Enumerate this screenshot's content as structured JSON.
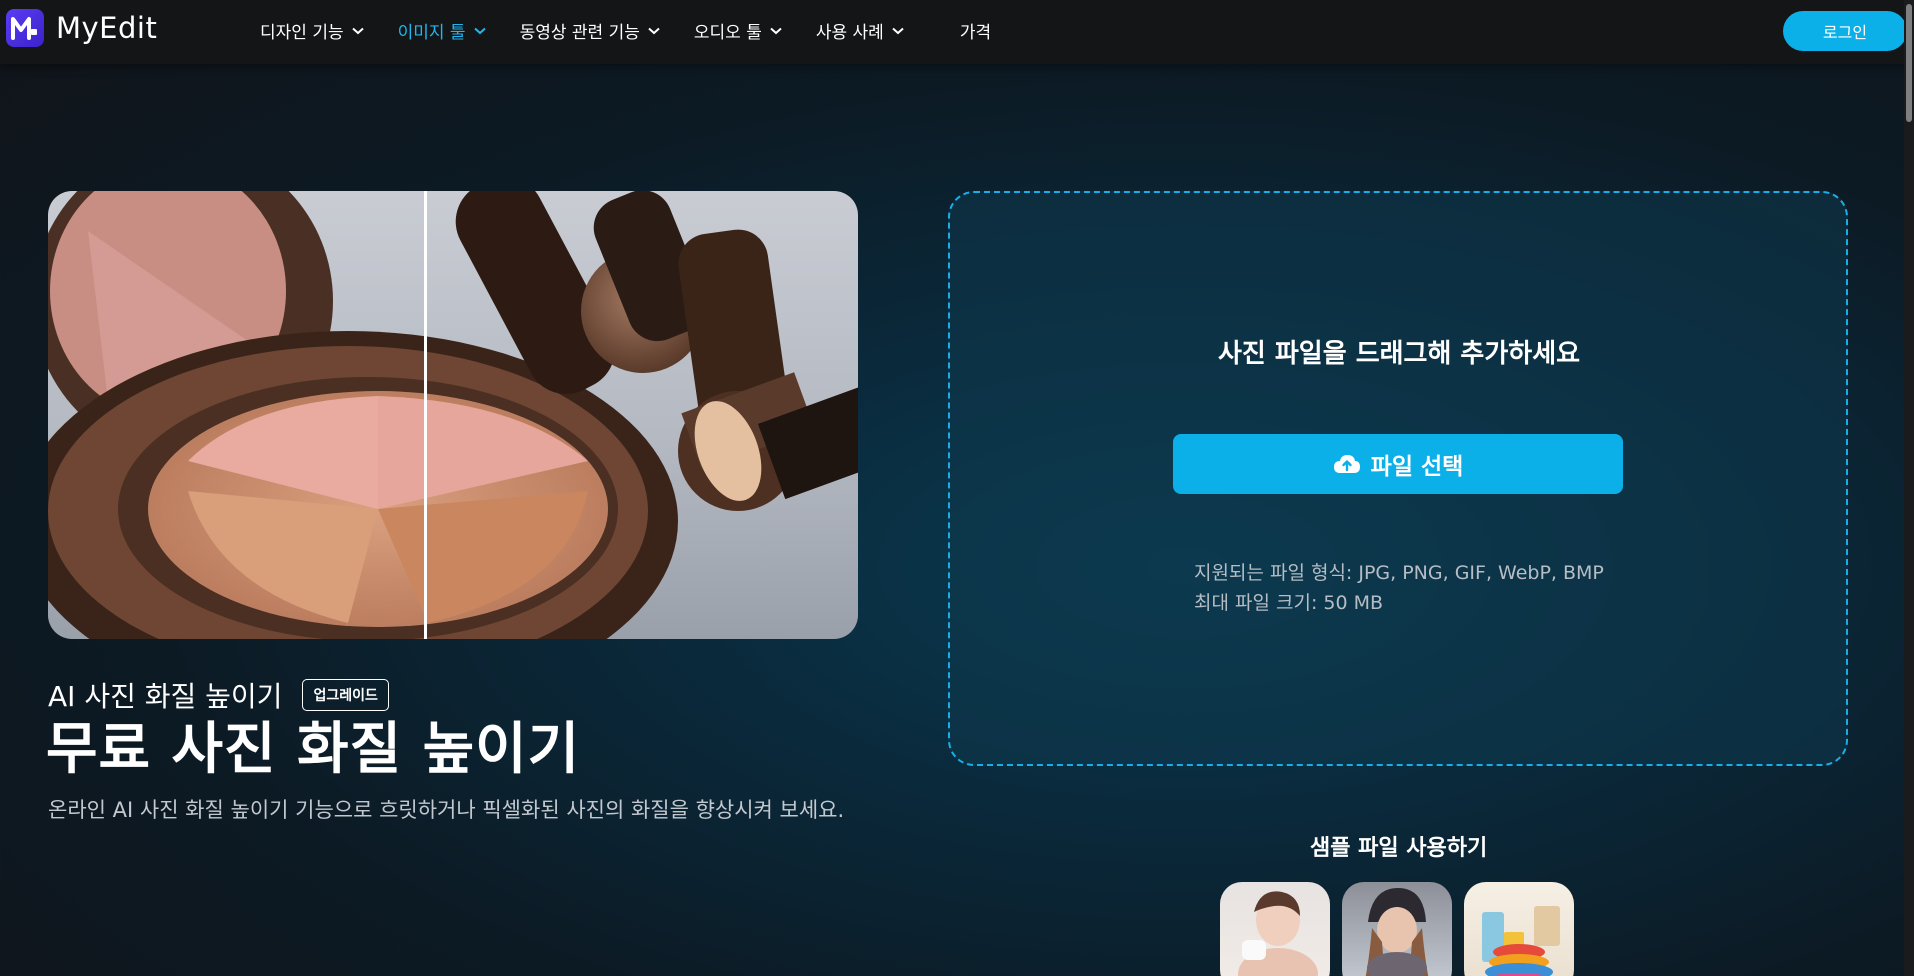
{
  "brand": {
    "name": "MyEdit"
  },
  "nav": {
    "items": [
      {
        "label": "디자인 기능",
        "has_dropdown": true,
        "active": false
      },
      {
        "label": "이미지 툴",
        "has_dropdown": true,
        "active": true
      },
      {
        "label": "동영상 관련 기능",
        "has_dropdown": true,
        "active": false
      },
      {
        "label": "오디오 툴",
        "has_dropdown": true,
        "active": false
      },
      {
        "label": "사용 사례",
        "has_dropdown": true,
        "active": false
      },
      {
        "label": "가격",
        "has_dropdown": false,
        "active": false
      }
    ],
    "login_label": "로그인"
  },
  "hero": {
    "section_label": "AI 사진 화질 높이기",
    "badge": "업그레이드",
    "title": "무료 사진 화질 높이기",
    "description": "온라인 AI 사진 화질 높이기 기능으로 흐릿하거나 픽셀화된 사진의 화질을 향상시켜 보세요."
  },
  "upload": {
    "drop_title": "사진 파일을 드래그해 추가하세요",
    "choose_label": "파일 선택",
    "formats_line": "지원되는 파일 형식: JPG, PNG, GIF, WebP, BMP",
    "size_line": "최대 파일 크기: 50 MB",
    "samples_title": "샘플 파일 사용하기"
  },
  "colors": {
    "accent": "#0bb0e8",
    "active_nav": "#1fb7ee",
    "header_bg": "#141516",
    "logo": "#4a2fe0"
  },
  "icons": [
    "logo-m-icon",
    "chevron-down-icon",
    "cloud-upload-icon"
  ]
}
